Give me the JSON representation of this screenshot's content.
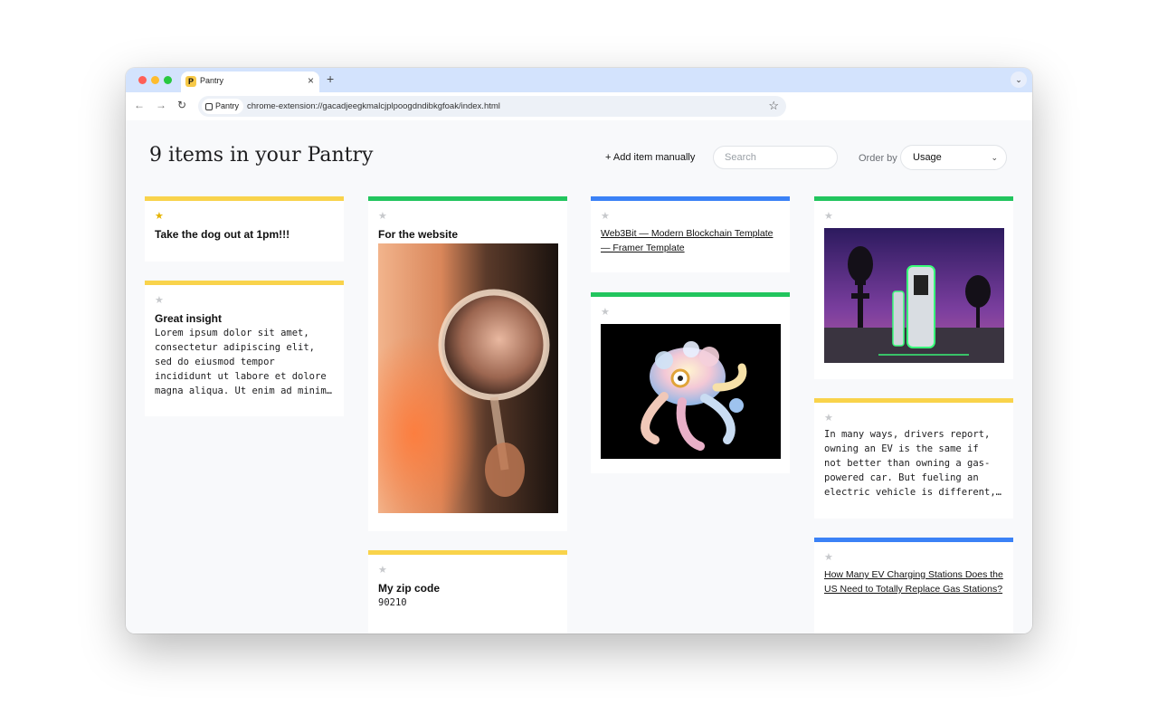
{
  "browser": {
    "tab_title": "Pantry",
    "tab_favicon": "P",
    "close_glyph": "×",
    "new_tab_glyph": "+",
    "tab_menu_glyph": "⌄",
    "back_glyph": "←",
    "forward_glyph": "→",
    "reload_glyph": "↻",
    "bookmark_glyph": "☆",
    "chip_label": "Pantry",
    "url": "chrome-extension://gacadjeegkmalcjplpoogdndibkgfoak/index.html"
  },
  "header": {
    "title": "9 items in your Pantry",
    "add_label": "+ Add item manually",
    "search_placeholder": "Search",
    "order_label": "Order by",
    "order_value": "Usage",
    "order_chevron": "⌄"
  },
  "star_glyph": "★",
  "colors": {
    "yellow": "#f9d34b",
    "green": "#22c55e",
    "blue": "#3b82f6",
    "star_on": "#e5b300",
    "star_off": "#c7c9cc"
  },
  "cards": [
    {
      "type": "note",
      "color": "yellow",
      "starred": true,
      "title": "Take the dog out at 1pm!!!"
    },
    {
      "type": "note",
      "color": "yellow",
      "starred": false,
      "title": "Great insight",
      "text": "Lorem ipsum dolor sit amet,\nconsectetur adipiscing elit,\nsed do eiusmod tempor\nincididunt ut labore et dolore\nmagna aliqua. Ut enim ad minim…"
    },
    {
      "type": "image",
      "color": "green",
      "starred": false,
      "title": "For the website",
      "image": "mirror-portrait-image"
    },
    {
      "type": "note",
      "color": "yellow",
      "starred": false,
      "title": "My zip code",
      "text": "90210"
    },
    {
      "type": "link",
      "color": "blue",
      "starred": false,
      "text": "Web3Bit — Modern Blockchain Template — Framer Template"
    },
    {
      "type": "image",
      "color": "green",
      "starred": false,
      "image": "octopus-render-image"
    },
    {
      "type": "image",
      "color": "green",
      "starred": false,
      "image": "ev-charger-night-image"
    },
    {
      "type": "note",
      "color": "yellow",
      "starred": false,
      "text": "In many ways, drivers report,\nowning an EV is the same if\nnot better than owning a gas-\npowered car. But fueling an\nelectric vehicle is different,…"
    },
    {
      "type": "link",
      "color": "blue",
      "starred": false,
      "text": "How Many EV Charging Stations Does the US Need to Totally Replace Gas Stations?"
    }
  ]
}
